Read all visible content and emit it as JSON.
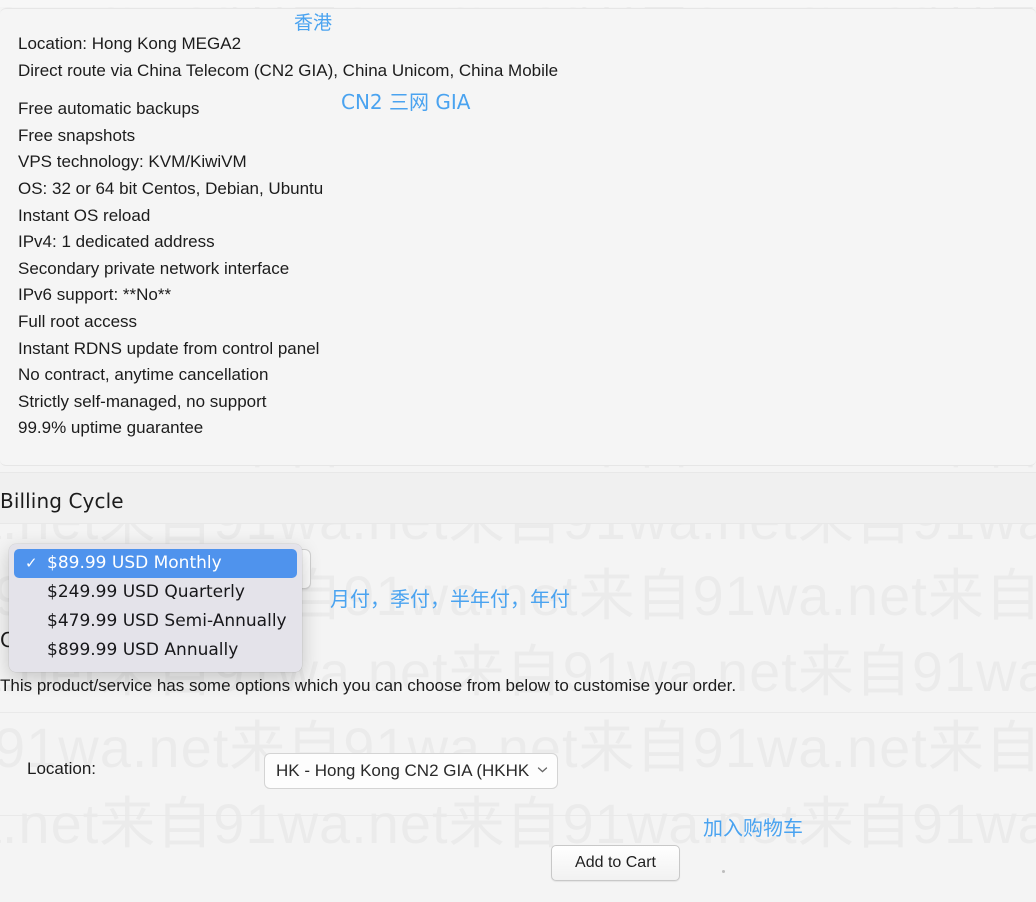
{
  "description": {
    "lines": [
      "Location: Hong Kong MEGA2",
      "Direct route via China Telecom (CN2 GIA), China Unicom, China Mobile"
    ],
    "features": [
      "Free automatic backups",
      "Free snapshots",
      "VPS technology: KVM/KiwiVM",
      "OS: 32 or 64 bit Centos, Debian, Ubuntu",
      "Instant OS reload",
      "IPv4: 1 dedicated address",
      "Secondary private network interface",
      "IPv6 support: **No**",
      "Full root access",
      "Instant RDNS update from control panel",
      "No contract, anytime cancellation",
      "Strictly self-managed, no support",
      "99.9% uptime guarantee"
    ]
  },
  "annotations": {
    "hong_kong": "香港",
    "cn2_gia": "CN2 三网 GIA",
    "billing_terms": "月付，季付，半年付，年付",
    "add_to_cart": "加入购物车",
    "color": "#4aa3f0"
  },
  "billing": {
    "section_title": "Billing Cycle",
    "selected_value": "$89.99 USD Monthly",
    "check_glyph": "✓",
    "chevron_glyph": "⌄",
    "options": [
      {
        "label": "$89.99 USD Monthly",
        "selected": true
      },
      {
        "label": "$249.99 USD Quarterly",
        "selected": false
      },
      {
        "label": "$479.99 USD Semi-Annually",
        "selected": false
      },
      {
        "label": "$899.99 USD Annually",
        "selected": false
      }
    ],
    "highlight_color": "#4f93ed"
  },
  "configurable": {
    "section_title": "C",
    "note": "This product/service has some options which you can choose from below to customise your order.",
    "location_label": "Location:",
    "location_value": "HK - Hong Kong CN2 GIA (HKHK",
    "chevron_glyph": "⌄"
  },
  "actions": {
    "add_to_cart_label": "Add to Cart"
  },
  "watermark": {
    "text": "来自91wa.net来自91wa.net来自91wa.net来自91wa.net来自91wa.net"
  }
}
